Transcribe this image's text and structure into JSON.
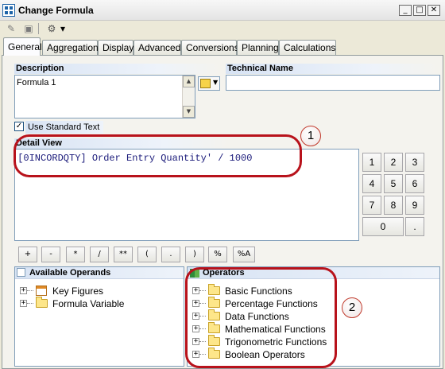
{
  "window": {
    "title": "Change Formula",
    "minimize": "_",
    "maximize": "□",
    "close": "✕"
  },
  "toolbar": {
    "icons": [
      "edit-icon",
      "save-icon",
      "settings-icon"
    ],
    "dropdown_arrow": "▾"
  },
  "tabs": [
    "General",
    "Aggregation",
    "Display",
    "Advanced",
    "Conversions",
    "Planning",
    "Calculations"
  ],
  "active_tab": "General",
  "description": {
    "label": "Description",
    "value": "Formula 1"
  },
  "technical_name": {
    "label": "Technical Name",
    "value": ""
  },
  "use_standard_text": {
    "label": "Use Standard Text",
    "checked": true,
    "mark": "✓"
  },
  "detail_view": {
    "label": "Detail View",
    "formula": "'[0INCORDQTY] Order Entry Quantity' / 1000"
  },
  "keypad": {
    "keys": [
      "1",
      "2",
      "3",
      "4",
      "5",
      "6",
      "7",
      "8",
      "9",
      "0",
      "."
    ]
  },
  "operator_buttons": [
    "+",
    "-",
    "*",
    "/",
    "**",
    "(",
    ".",
    ")",
    "%",
    "%A"
  ],
  "available_operands": {
    "label": "Available Operands",
    "items": [
      "Key Figures",
      "Formula Variable"
    ]
  },
  "operators": {
    "label": "Operators",
    "items": [
      "Basic Functions",
      "Percentage Functions",
      "Data Functions",
      "Mathematical Functions",
      "Trigonometric Functions",
      "Boolean Operators"
    ]
  },
  "callouts": [
    "1",
    "2"
  ],
  "colors": {
    "callout": "#b8121b",
    "label_gradient": "#d7e3f4",
    "formula_text": "#1a1a7a"
  }
}
